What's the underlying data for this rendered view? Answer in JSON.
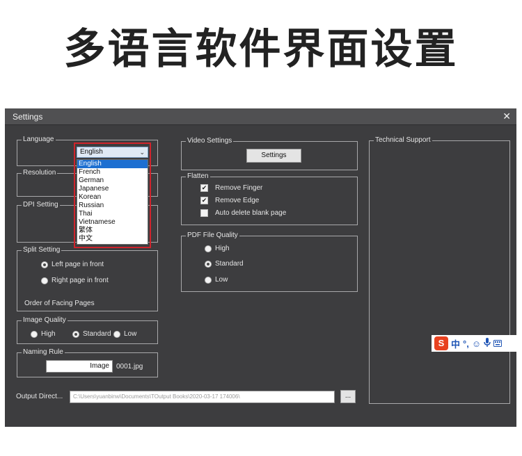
{
  "headline": "多语言软件界面设置",
  "window": {
    "title": "Settings",
    "close": "✕"
  },
  "language": {
    "legend": "Language",
    "selected": "English",
    "options": [
      "English",
      "French",
      "German",
      "Japanese",
      "Korean",
      "Russian",
      "Thai",
      "Vietnamese",
      "繁体",
      "中文"
    ]
  },
  "resolution": {
    "legend": "Resolution"
  },
  "dpi": {
    "legend": "DPI Setting"
  },
  "split": {
    "legend": "Split Setting",
    "options": [
      {
        "label": "Left page in front",
        "selected": true
      },
      {
        "label": "Right page in front",
        "selected": false
      }
    ],
    "order_label": "Order of Facing Pages"
  },
  "image_quality": {
    "legend": "Image Quality",
    "options": [
      {
        "label": "High",
        "selected": false
      },
      {
        "label": "Standard",
        "selected": true
      },
      {
        "label": "Low",
        "selected": false
      }
    ]
  },
  "naming": {
    "legend": "Naming Rule",
    "value": "Image",
    "suffix": "0001.jpg"
  },
  "output": {
    "label": "Output Direct...",
    "path": "C:\\Users\\yuanbinw\\Documents\\TOutput Books\\2020-03-17 174006\\",
    "browse_label": "..."
  },
  "video": {
    "legend": "Video Settings",
    "button_label": "Settings"
  },
  "flatten": {
    "legend": "Flatten",
    "items": [
      {
        "label": "Remove Finger",
        "checked": true
      },
      {
        "label": "Remove Edge",
        "checked": true
      },
      {
        "label": "Auto delete blank page",
        "checked": false
      }
    ]
  },
  "pdf_quality": {
    "legend": "PDF File Quality",
    "options": [
      {
        "label": "High",
        "selected": false
      },
      {
        "label": "Standard",
        "selected": true
      },
      {
        "label": "Low",
        "selected": false
      }
    ]
  },
  "tech_support": {
    "legend": "Technical Support"
  },
  "ime": {
    "logo": "S",
    "mode": "中",
    "punct": "°,",
    "icons": [
      "smiley-icon",
      "microphone-icon",
      "keyboard-icon"
    ]
  },
  "colors": {
    "window_bg": "#3d3d3f",
    "highlight": "#d0242c",
    "selected_option": "#1d6fd1",
    "ime_logo": "#e8411f"
  }
}
